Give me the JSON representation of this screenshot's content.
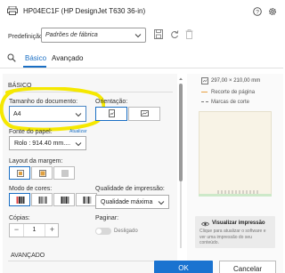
{
  "window": {
    "title": "HP04EC1F (HP DesignJet T630 36-in)"
  },
  "preset": {
    "label": "Predefinição:",
    "value": "Padrões de fábrica"
  },
  "tabs": [
    {
      "label": "Básico",
      "active": true
    },
    {
      "label": "Avançado",
      "active": false
    }
  ],
  "basic_section": {
    "title": "BÁSICO",
    "document_size": {
      "label": "Tamanho do documento:",
      "value": "A4"
    },
    "orientation": {
      "label": "Orientação:",
      "selected": "portrait"
    },
    "paper_source": {
      "label": "Fonte do papel:",
      "update_link": "Atualizar",
      "value": "Rolo : 914.40 mm...."
    },
    "margin_layout": {
      "label": "Layout da margem:",
      "selected_index": 0
    },
    "color_mode": {
      "label": "Modo de cores:",
      "selected_index": 0
    },
    "print_quality": {
      "label": "Qualidade de impressão:",
      "value": "Qualidade máxima"
    },
    "copies": {
      "label": "Cópias:",
      "value": "1",
      "minus": "−",
      "plus": "+"
    },
    "paginate": {
      "label": "Paginar:",
      "state_label": "Desligado",
      "on": false
    }
  },
  "advanced_section": {
    "title": "AVANÇADO"
  },
  "preview_legend": {
    "size_text": "297,00 × 210,00 mm",
    "crop_label": "Recorte de página",
    "cut_marks_label": "Marcas de corte"
  },
  "preview_tip": {
    "title": "Visualizar impressão",
    "description": "Clique para atualizar o software e ver uma impressão do seu conteúdo."
  },
  "buttons": {
    "ok": "OK",
    "cancel": "Cancelar"
  },
  "colors": {
    "accent": "#1a73d0",
    "highlight_ring": "#f5e800",
    "crop_line": "#e8a040"
  }
}
